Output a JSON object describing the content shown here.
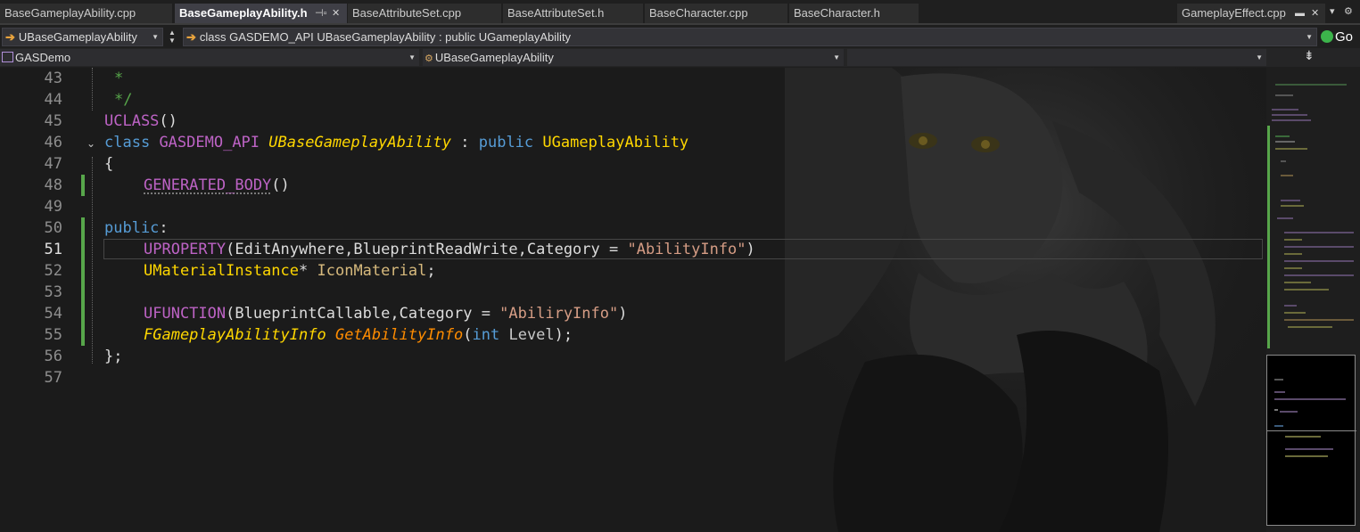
{
  "tabs": [
    {
      "label": "BaseGameplayAbility.cpp"
    },
    {
      "label": "BaseGameplayAbility.h"
    },
    {
      "label": "BaseAttributeSet.cpp"
    },
    {
      "label": "BaseAttributeSet.h"
    },
    {
      "label": "BaseCharacter.cpp"
    },
    {
      "label": "BaseCharacter.h"
    },
    {
      "label": "GameplayEffect.cpp"
    }
  ],
  "nav": {
    "class_dropdown": "UBaseGameplayAbility",
    "signature_dropdown": "class GASDEMO_API UBaseGameplayAbility : public UGameplayAbility",
    "go_label": "Go",
    "project_dropdown": "GASDemo",
    "scope_dropdown": "UBaseGameplayAbility",
    "member_dropdown": ""
  },
  "editor": {
    "line_numbers": [
      "43",
      "44",
      "45",
      "46",
      "47",
      "48",
      "49",
      "50",
      "51",
      "52",
      "53",
      "54",
      "55",
      "56",
      "57"
    ],
    "current_line": "51",
    "code": {
      "l43_star": "*",
      "l44_end": "*/",
      "l45_macro": "UCLASS",
      "l45_parens": "()",
      "l46_class_kw": "class",
      "l46_api": "GASDEMO_API",
      "l46_name": "UBaseGameplayAbility",
      "l46_colon": ":",
      "l46_public": "public",
      "l46_base": "UGameplayAbility",
      "l47_brace": "{",
      "l48_macro": "GENERATED_BODY",
      "l48_parens": "()",
      "l50_public": "public",
      "l50_colon": ":",
      "l51_macro": "UPROPERTY",
      "l51_args": "(EditAnywhere,BlueprintReadWrite,Category = ",
      "l51_str": "\"AbilityInfo\"",
      "l51_close": ")",
      "l52_type": "UMaterialInstance",
      "l52_ptr": "*",
      "l52_var": "IconMaterial",
      "l52_semi": ";",
      "l54_macro": "UFUNCTION",
      "l54_args": "(BlueprintCallable,Category = ",
      "l54_str": "\"AbiliryInfo\"",
      "l54_close": ")",
      "l55_type": "FGameplayAbilityInfo",
      "l55_func": "GetAbilityInfo",
      "l55_open": "(",
      "l55_int": "int",
      "l55_param": "Level",
      "l55_close": ");",
      "l56_end": "};"
    }
  },
  "colors": {
    "keyword": "#569cd6",
    "macro": "#bd63c5",
    "type": "#ffd700",
    "string": "#d69d85",
    "comment": "#57a64a",
    "function": "#ff8c00",
    "modified_bar": "#57a64a"
  }
}
